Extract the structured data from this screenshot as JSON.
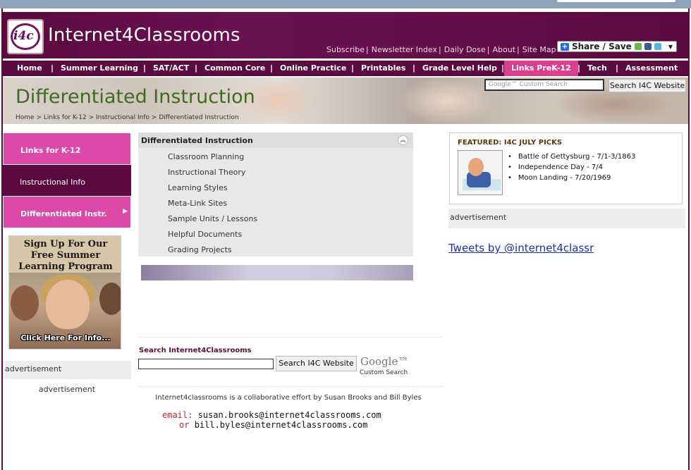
{
  "header": {
    "logo_text": "i4c",
    "site_title": "Internet4Classrooms",
    "links": [
      "Subscribe",
      "Newsletter Index",
      "Daily Dose",
      "About",
      "Site Map"
    ],
    "share_label": "Share / Save"
  },
  "nav": {
    "items": [
      "Home",
      "Summer Learning",
      "SAT/ACT",
      "Common Core",
      "Online Practice",
      "Printables",
      "Grade Level Help",
      "Links PreK-12",
      "Tech",
      "Assessment"
    ],
    "active": "Links PreK-12"
  },
  "banner": {
    "title": "Differentiated Instruction",
    "breadcrumb": [
      "Home",
      "Links for K-12",
      "Instructional Info",
      "Differentiated Instruction"
    ],
    "search_placeholder": "Google™ Custom Search",
    "search_button": "Search I4C Website"
  },
  "sidebar": {
    "items": [
      {
        "label": "Links for K-12",
        "style": "pink"
      },
      {
        "label": "Instructional Info",
        "style": "dark"
      },
      {
        "label": "Differentiated Instr.",
        "style": "pink"
      }
    ],
    "promo": {
      "headline_lines": [
        "Sign Up For Our",
        "Free Summer",
        "Learning Program"
      ],
      "cta": "Click Here For Info..."
    },
    "ad_label": "advertisement",
    "ad_label_2": "advertisement"
  },
  "main": {
    "menu_title": "Differentiated Instruction",
    "menu_links": [
      "Classroom Planning",
      "Instructional Theory",
      "Learning Styles",
      "Meta-Link Sites",
      "Sample Units / Lessons",
      "Helpful Documents",
      "Grading Projects"
    ],
    "search_label": "Search Internet4Classrooms",
    "search_value": "",
    "search_button": "Search I4C Website",
    "google_logo": "Google™",
    "google_caption": "Custom Search",
    "collab_text": "Internet4classrooms is a collaborative effort by Susan Brooks and Bill Byles",
    "email_key": "email:",
    "email_1": "susan.brooks@internet4classrooms.com",
    "or_key": "or",
    "email_2": "bill.byles@internet4classrooms.com"
  },
  "featured": {
    "title": "FEATURED: I4C JULY PICKS",
    "items": [
      "Battle of Gettysburg - 7/1-3/1863",
      "Independence Day - 7/4",
      "Moon Landing - 7/20/1969"
    ]
  },
  "right": {
    "ad_label": "advertisement",
    "tweets_link": "Tweets by @internet4classr"
  }
}
